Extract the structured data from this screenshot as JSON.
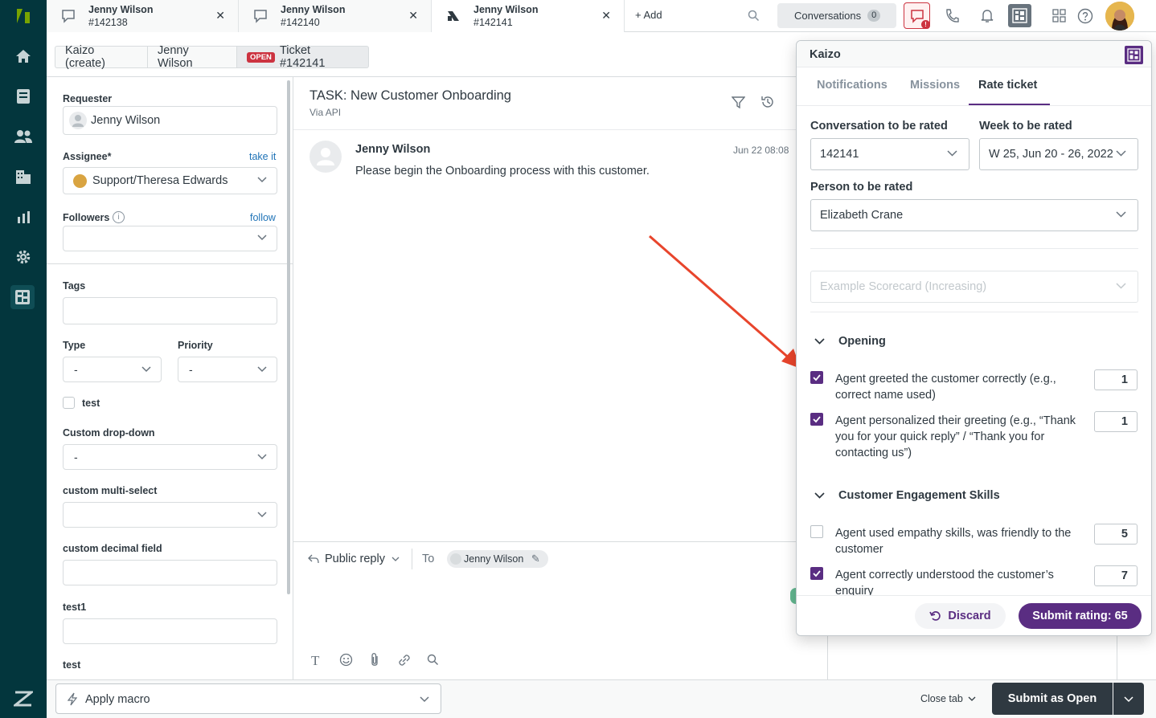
{
  "tabs": [
    {
      "name": "Jenny Wilson",
      "num": "#142138"
    },
    {
      "name": "Jenny Wilson",
      "num": "#142140"
    },
    {
      "name": "Jenny Wilson",
      "num": "#142141"
    }
  ],
  "topbar": {
    "add_label": "Add",
    "conversations_label": "Conversations",
    "conversations_count": "0",
    "alert_badge": "!"
  },
  "breadcrumb": {
    "item1": "Kaizo (create)",
    "item2": "Jenny Wilson",
    "status_badge": "OPEN",
    "ticket": "Ticket #142141"
  },
  "sidebar": {
    "requester_label": "Requester",
    "requester_value": "Jenny Wilson",
    "assignee_label": "Assignee*",
    "take_it": "take it",
    "assignee_value": "Support/Theresa Edwards",
    "followers_label": "Followers",
    "follow_link": "follow",
    "tags_label": "Tags",
    "type_label": "Type",
    "type_value": "-",
    "priority_label": "Priority",
    "priority_value": "-",
    "test_checkbox_label": "test",
    "custom_dropdown_label": "Custom drop-down",
    "custom_dropdown_value": "-",
    "multiselect_label": "custom multi-select",
    "decimal_label": "custom decimal field",
    "test1_label": "test1",
    "test_label": "test"
  },
  "ticket": {
    "title": "TASK: New Customer Onboarding",
    "via": "Via API",
    "author": "Jenny Wilson",
    "time": "Jun 22 08:08",
    "message": "Please begin the Onboarding process with this customer."
  },
  "reply": {
    "mode": "Public reply",
    "to_label": "To",
    "recipient": "Jenny Wilson"
  },
  "footer": {
    "macro": "Apply macro",
    "close_tab": "Close tab",
    "submit": "Submit as Open"
  },
  "kaizo": {
    "title": "Kaizo",
    "tabs": [
      "Notifications",
      "Missions",
      "Rate ticket"
    ],
    "active_tab": "Rate ticket",
    "conv_label": "Conversation to be rated",
    "conv_value": "142141",
    "week_label": "Week to be rated",
    "week_value": "W 25, Jun 20 - 26, 2022",
    "person_label": "Person to be rated",
    "person_value": "Elizabeth Crane",
    "scorecard_placeholder": "Example Scorecard (Increasing)",
    "sections": [
      {
        "title": "Opening",
        "criteria": [
          {
            "text": "Agent greeted the customer correctly (e.g., correct name used)",
            "checked": true,
            "score": "1"
          },
          {
            "text": "Agent personalized their greeting (e.g., “Thank you for your quick reply” / “Thank you for contacting us”)",
            "checked": true,
            "score": "1"
          }
        ]
      },
      {
        "title": "Customer Engagement Skills",
        "criteria": [
          {
            "text": "Agent used empathy skills, was friendly to the customer",
            "checked": false,
            "score": "5"
          },
          {
            "text": "Agent correctly understood the customer’s enquiry",
            "checked": true,
            "score": "7"
          }
        ]
      }
    ],
    "discard": "Discard",
    "submit": "Submit rating: 65"
  },
  "colors": {
    "nav": "#03363d",
    "kaizo_purple": "#5a2d82",
    "annotation_arrow": "#e8452c",
    "open_badge": "#cc3340"
  }
}
